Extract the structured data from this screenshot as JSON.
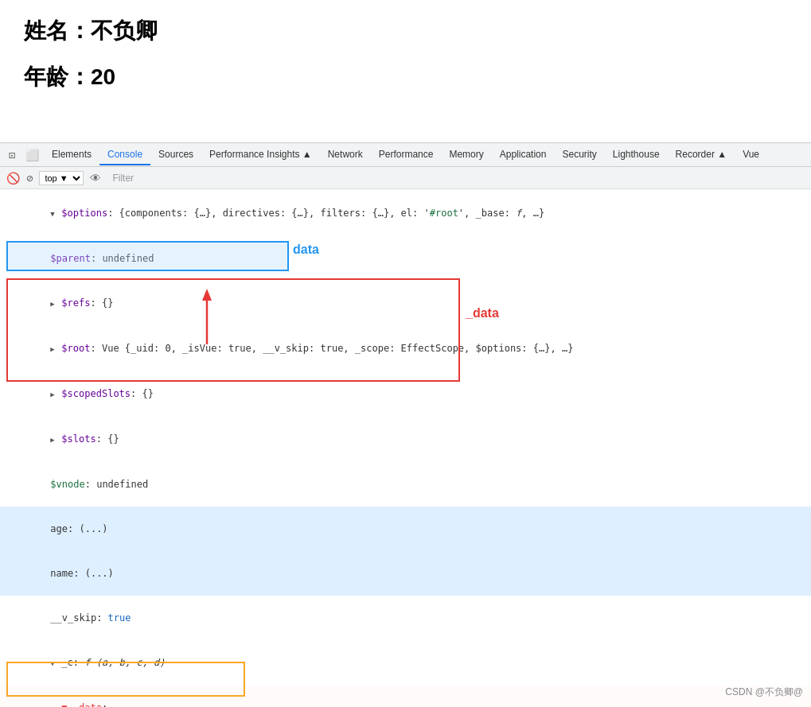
{
  "page": {
    "title_name": "姓名：不负卿",
    "title_age": "年龄：20"
  },
  "devtools": {
    "tabs": [
      {
        "label": "Elements",
        "active": false
      },
      {
        "label": "Console",
        "active": true
      },
      {
        "label": "Sources",
        "active": false
      },
      {
        "label": "Performance Insights ▲",
        "active": false
      },
      {
        "label": "Network",
        "active": false
      },
      {
        "label": "Performance",
        "active": false
      },
      {
        "label": "Memory",
        "active": false
      },
      {
        "label": "Application",
        "active": false
      },
      {
        "label": "Security",
        "active": false
      },
      {
        "label": "Lighthouse",
        "active": false
      },
      {
        "label": "Recorder ▲",
        "active": false
      },
      {
        "label": "Vue",
        "active": false
      }
    ],
    "toolbar": {
      "context": "top",
      "filter_placeholder": "Filter"
    }
  },
  "labels": {
    "data": "data",
    "_data": "_data"
  },
  "watermark": "CSDN @不负卿@"
}
